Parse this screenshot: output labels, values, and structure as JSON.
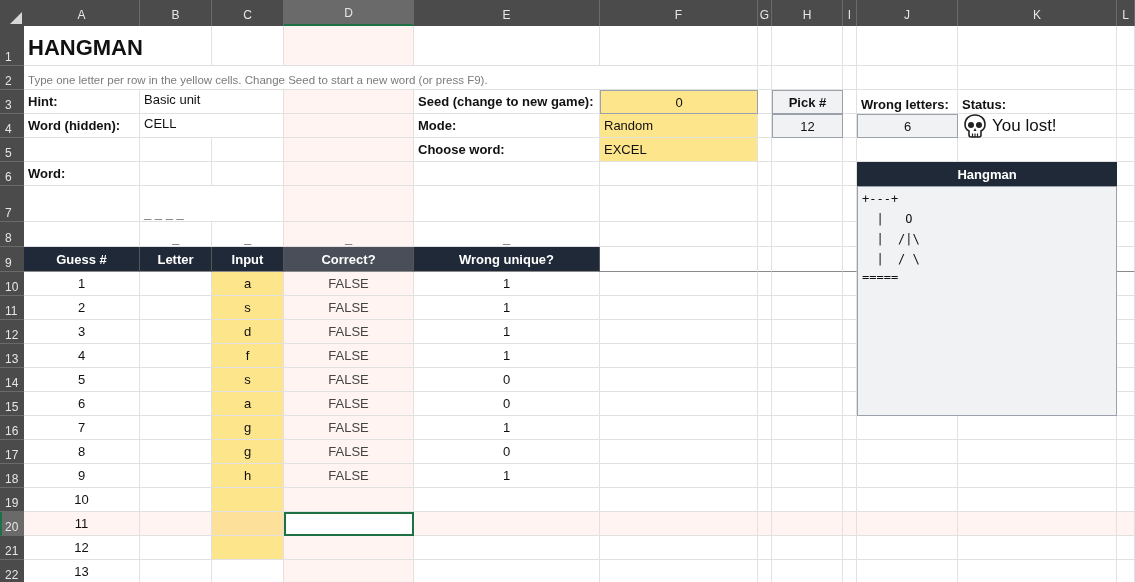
{
  "column_headers": [
    {
      "label": "A",
      "selected": false
    },
    {
      "label": "B",
      "selected": false
    },
    {
      "label": "C",
      "selected": false
    },
    {
      "label": "D",
      "selected": true
    },
    {
      "label": "E",
      "selected": false
    },
    {
      "label": "F",
      "selected": false
    },
    {
      "label": "G",
      "selected": false
    },
    {
      "label": "H",
      "selected": false
    },
    {
      "label": "I",
      "selected": false
    },
    {
      "label": "J",
      "selected": false
    },
    {
      "label": "K",
      "selected": false
    },
    {
      "label": "L",
      "selected": false
    }
  ],
  "row_headers": [
    {
      "label": "1",
      "selected": false
    },
    {
      "label": "2",
      "selected": false
    },
    {
      "label": "3",
      "selected": false
    },
    {
      "label": "4",
      "selected": false
    },
    {
      "label": "5",
      "selected": false
    },
    {
      "label": "6",
      "selected": false
    },
    {
      "label": "7",
      "selected": false
    },
    {
      "label": "8",
      "selected": false
    },
    {
      "label": "9",
      "selected": false
    },
    {
      "label": "10",
      "selected": false
    },
    {
      "label": "11",
      "selected": false
    },
    {
      "label": "12",
      "selected": false
    },
    {
      "label": "13",
      "selected": false
    },
    {
      "label": "14",
      "selected": false
    },
    {
      "label": "15",
      "selected": false
    },
    {
      "label": "16",
      "selected": false
    },
    {
      "label": "17",
      "selected": false
    },
    {
      "label": "18",
      "selected": false
    },
    {
      "label": "19",
      "selected": false
    },
    {
      "label": "20",
      "selected": true
    },
    {
      "label": "21",
      "selected": false
    },
    {
      "label": "22",
      "selected": false
    }
  ],
  "title": "HANGMAN",
  "instructions": "Type one letter per row in the yellow cells. Change Seed to start a new word (or press F9).",
  "hint": {
    "label": "Hint:",
    "value": "Basic unit"
  },
  "hidden_word": {
    "label": "Word (hidden):",
    "value": "CELL"
  },
  "seed": {
    "label": "Seed (change to new game):",
    "value": "0"
  },
  "mode": {
    "label": "Mode:",
    "value": "Random"
  },
  "choose_word": {
    "label": "Choose word:",
    "value": "EXCEL"
  },
  "pick": {
    "label": "Pick #",
    "value": "12"
  },
  "wrong_letters": {
    "label": "Wrong letters:",
    "value": "6"
  },
  "status": {
    "label": "Status:",
    "value": "You lost!"
  },
  "word": {
    "label": "Word:",
    "display": "_ _ _ _"
  },
  "underscores": [
    "_",
    "_",
    "_",
    "_"
  ],
  "table": {
    "columns": [
      "Guess #",
      "Letter",
      "Input",
      "Correct?",
      "Wrong unique?"
    ],
    "rows": [
      {
        "number": "1",
        "input": "a",
        "correct": "FALSE",
        "wrong_unique": "1",
        "editable": true,
        "selected": false
      },
      {
        "number": "2",
        "input": "s",
        "correct": "FALSE",
        "wrong_unique": "1",
        "editable": true,
        "selected": false
      },
      {
        "number": "3",
        "input": "d",
        "correct": "FALSE",
        "wrong_unique": "1",
        "editable": true,
        "selected": false
      },
      {
        "number": "4",
        "input": "f",
        "correct": "FALSE",
        "wrong_unique": "1",
        "editable": true,
        "selected": false
      },
      {
        "number": "5",
        "input": "s",
        "correct": "FALSE",
        "wrong_unique": "0",
        "editable": true,
        "selected": false
      },
      {
        "number": "6",
        "input": "a",
        "correct": "FALSE",
        "wrong_unique": "0",
        "editable": true,
        "selected": false
      },
      {
        "number": "7",
        "input": "g",
        "correct": "FALSE",
        "wrong_unique": "1",
        "editable": true,
        "selected": false
      },
      {
        "number": "8",
        "input": "g",
        "correct": "FALSE",
        "wrong_unique": "0",
        "editable": true,
        "selected": false
      },
      {
        "number": "9",
        "input": "h",
        "correct": "FALSE",
        "wrong_unique": "1",
        "editable": true,
        "selected": false
      },
      {
        "number": "10",
        "editable": true,
        "selected": false
      },
      {
        "number": "11",
        "editable": true,
        "selected": true
      },
      {
        "number": "12",
        "editable": true,
        "selected": false
      },
      {
        "number": "13",
        "editable": false,
        "selected": false
      }
    ]
  },
  "hangman": {
    "title": "Hangman",
    "art": [
      "+---+",
      "  |   O",
      "  |  /|\\",
      "  |  / \\",
      "====="
    ]
  }
}
